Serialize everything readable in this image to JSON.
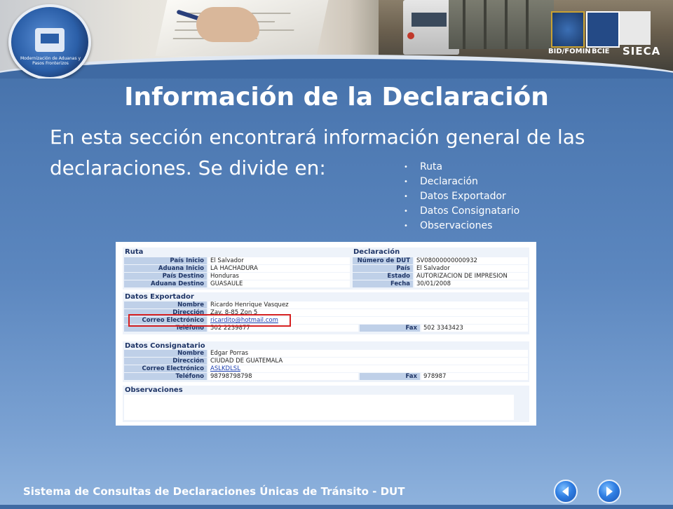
{
  "header": {
    "logo_text": "Modernización de Aduanas y Pasos Fronterizos",
    "sponsors": [
      "BID/FOMIN",
      "BCIE",
      "SIECA"
    ]
  },
  "slide": {
    "title": "Información de la Declaración",
    "intro_line1": "En esta sección encontrará información general de las",
    "intro_line2": "declaraciones.  Se divide en:",
    "bullets": [
      "Ruta",
      "Declaración",
      "Datos Exportador",
      "Datos Consignatario",
      "Observaciones"
    ]
  },
  "form": {
    "ruta": {
      "title": "Ruta",
      "rows": [
        {
          "label": "País Inicio",
          "value": "El Salvador"
        },
        {
          "label": "Aduana Inicio",
          "value": "LA HACHADURA"
        },
        {
          "label": "País Destino",
          "value": "Honduras"
        },
        {
          "label": "Aduana Destino",
          "value": "GUASAULE"
        }
      ]
    },
    "declaracion": {
      "title": "Declaración",
      "rows": [
        {
          "label": "Número de DUT",
          "value": "SV08000000000932"
        },
        {
          "label": "País",
          "value": "El Salvador"
        },
        {
          "label": "Estado",
          "value": "AUTORIZACION DE IMPRESION"
        },
        {
          "label": "Fecha",
          "value": "30/01/2008"
        }
      ]
    },
    "exportador": {
      "title": "Datos Exportador",
      "nombre_label": "Nombre",
      "nombre": "Ricardo Henrique Vasquez",
      "direccion_label": "Dirección",
      "direccion": "Zav. 8-85 Zon 5",
      "correo_label": "Correo Electrónico",
      "correo": "ricardito@hotmail.com",
      "telefono_label": "Teléfono",
      "telefono": "502 2239877",
      "fax_label": "Fax",
      "fax": "502 3343423"
    },
    "consignatario": {
      "title": "Datos Consignatario",
      "nombre_label": "Nombre",
      "nombre": "Edgar Porras",
      "direccion_label": "Dirección",
      "direccion": "CIUDAD DE GUATEMALA",
      "correo_label": "Correo Electrónico",
      "correo": "ASLKDLSL",
      "telefono_label": "Teléfono",
      "telefono": "98798798798",
      "fax_label": "Fax",
      "fax": "978987"
    },
    "observaciones": {
      "title": "Observaciones",
      "value": ""
    }
  },
  "footer": {
    "text": "Sistema de Consultas de Declaraciones Únicas de Tránsito - DUT",
    "prev_icon": "arrow-left-icon",
    "next_icon": "arrow-right-icon"
  },
  "colors": {
    "accent": "#2f7ee3",
    "highlight": "#d62222",
    "label_bg": "#bfd0e8"
  }
}
